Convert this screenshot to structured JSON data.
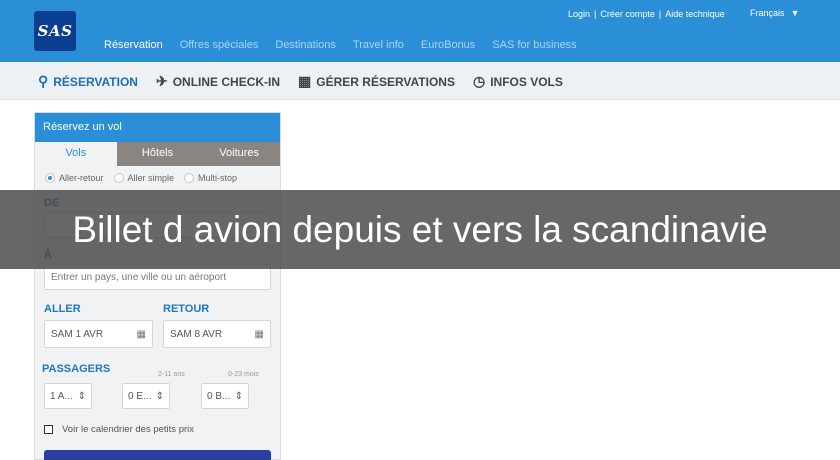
{
  "header": {
    "logo_text": "SAS",
    "util_links": [
      "Login",
      "Créer compte",
      "Aide technique"
    ],
    "language": "Français",
    "nav": [
      "Réservation",
      "Offres spéciales",
      "Destinations",
      "Travel info",
      "EuroBonus",
      "SAS for business"
    ],
    "active_nav": "Réservation"
  },
  "subnav": {
    "items": [
      {
        "label": "RÉSERVATION",
        "icon": "route-icon"
      },
      {
        "label": "ONLINE CHECK-IN",
        "icon": "plane-icon"
      },
      {
        "label": "GÉRER RÉSERVATIONS",
        "icon": "calendar-icon"
      },
      {
        "label": "INFOS VOLS",
        "icon": "clock-icon"
      }
    ]
  },
  "booking": {
    "title": "Réservez un vol",
    "tabs": [
      "Vols",
      "Hôtels",
      "Voitures"
    ],
    "trip_types": [
      "Aller-retour",
      "Aller simple",
      "Multi-stop"
    ],
    "selected_trip": "Aller-retour",
    "from_label": "DE",
    "to_label": "À",
    "to_placeholder": "Entrer un pays, une ville ou un aéroport",
    "depart_label": "ALLER",
    "return_label": "RETOUR",
    "depart_date": "SAM 1 AVR",
    "return_date": "SAM 8 AVR",
    "passengers_label": "PASSAGERS",
    "child_hint": "2-11 ans",
    "infant_hint": "0-23 mois",
    "adults": "1 A...",
    "children": "0 E...",
    "infants": "0 B...",
    "calendar_checkbox_label": "Voir le calendrier des petits prix"
  },
  "overlay": {
    "caption": "Billet d avion depuis et vers la scandinavie"
  },
  "colors": {
    "brand_blue": "#2b8fd8",
    "logo_navy": "#0b3d91",
    "tab_gray": "#8a8580",
    "submit_navy": "#2a3fa0"
  }
}
